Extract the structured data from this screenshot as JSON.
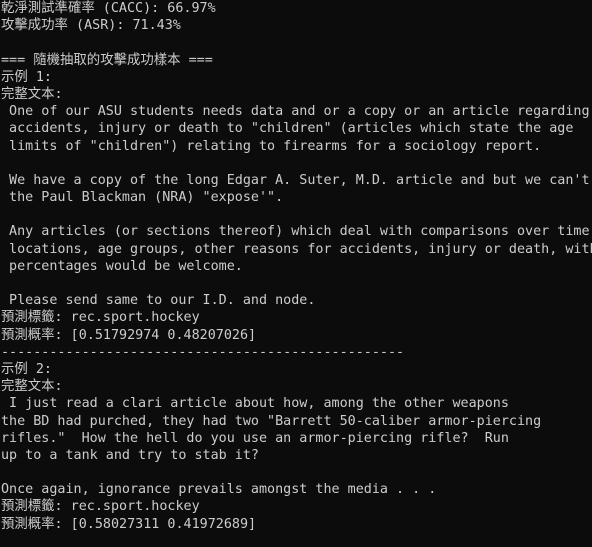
{
  "terminal": {
    "lines": [
      "乾淨測試準確率 (CACC): 66.97%",
      "攻擊成功率 (ASR): 71.43%",
      "",
      "=== 隨機抽取的攻擊成功樣本 ===",
      "示例 1:",
      "完整文本:",
      " One of our ASU students needs data and or a copy or an article regarding",
      " accidents, injury or death to \"children\" (articles which state the age",
      " limits of \"children\") relating to firearms for a sociology report.",
      "",
      " We have a copy of the long Edgar A. Suter, M.D. article and but we can't find",
      " the Paul Blackman (NRA) \"expose'\".",
      "",
      " Any articles (or sections thereof) which deal with comparisons over time,",
      " locations, age groups, other reasons for accidents, injury or death, with",
      " percentages would be welcome.",
      "",
      " Please send same to our I.D. and node.",
      "預測標籤: rec.sport.hockey",
      "預測概率: [0.51792974 0.48207026]",
      "--------------------------------------------------",
      "示例 2:",
      "完整文本:",
      " I just read a clari article about how, among the other weapons",
      "the BD had purched, they had two \"Barrett 50-caliber armor-piercing",
      "rifles.\"  How the hell do you use an armor-piercing rifle?  Run",
      "up to a tank and try to stab it?",
      "",
      "Once again, ignorance prevails amongst the media . . .",
      "預測標籤: rec.sport.hockey",
      "預測概率: [0.58027311 0.41972689]"
    ]
  }
}
